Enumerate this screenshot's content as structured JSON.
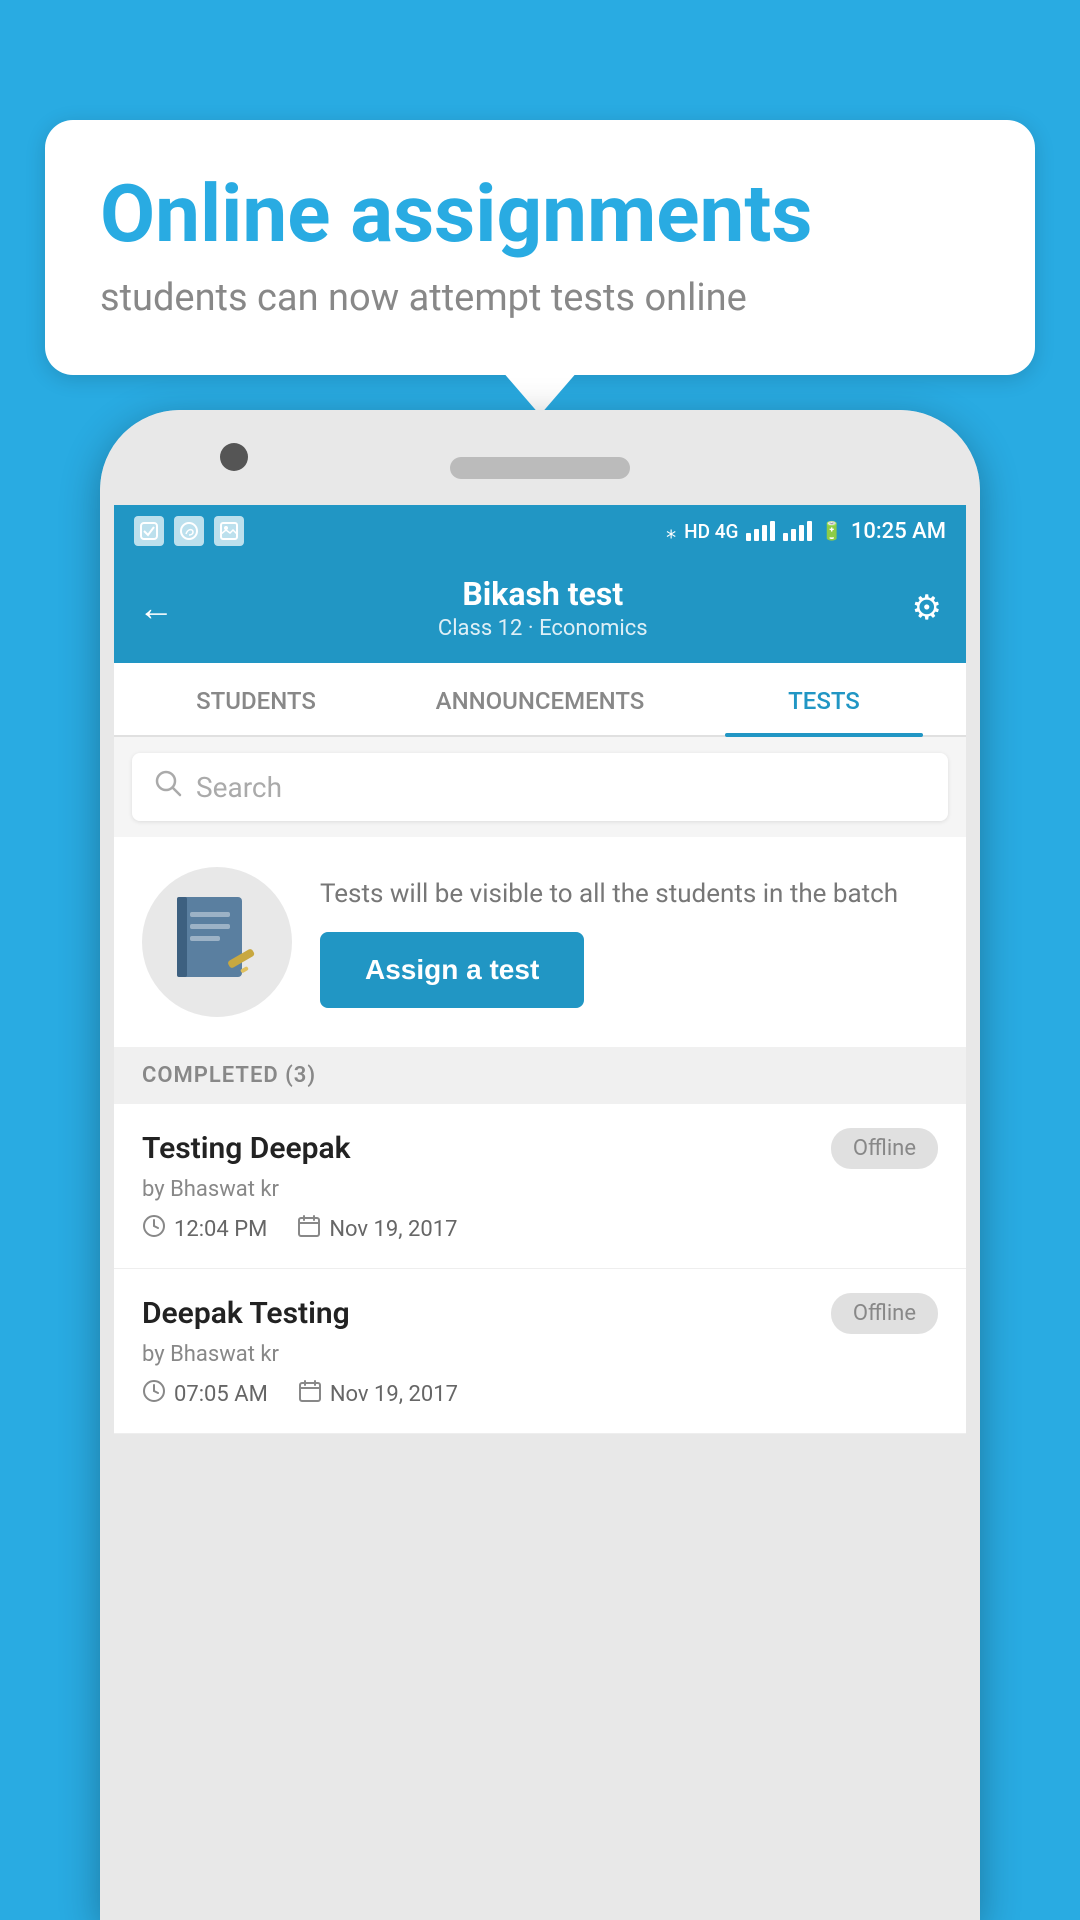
{
  "background_color": "#29ABE2",
  "speech_bubble": {
    "title": "Online assignments",
    "subtitle": "students can now attempt tests online"
  },
  "status_bar": {
    "time": "10:25 AM",
    "network": "HD 4G",
    "bluetooth": "⁎"
  },
  "app_header": {
    "title": "Bikash test",
    "subtitle": "Class 12 · Economics",
    "back_label": "←",
    "settings_label": "⚙"
  },
  "tabs": [
    {
      "label": "STUDENTS",
      "active": false
    },
    {
      "label": "ANNOUNCEMENTS",
      "active": false
    },
    {
      "label": "TESTS",
      "active": true
    }
  ],
  "search": {
    "placeholder": "Search"
  },
  "assign_section": {
    "description": "Tests will be visible to all the students in the batch",
    "button_label": "Assign a test"
  },
  "completed_header": "COMPLETED (3)",
  "test_items": [
    {
      "name": "Testing Deepak",
      "author": "by Bhaswat kr",
      "time": "12:04 PM",
      "date": "Nov 19, 2017",
      "badge": "Offline"
    },
    {
      "name": "Deepak Testing",
      "author": "by Bhaswat kr",
      "time": "07:05 AM",
      "date": "Nov 19, 2017",
      "badge": "Offline"
    }
  ]
}
